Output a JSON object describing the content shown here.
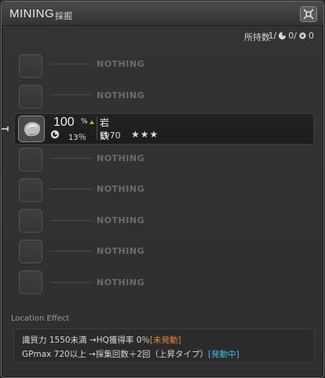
{
  "window": {
    "title": "MINING",
    "subtitle": "採掘",
    "close_icon": "settings-close-icon"
  },
  "header": {
    "holdings_label": "所持数",
    "holdings_prefix": "1/",
    "hq_count": "0/",
    "collectable_count": "0"
  },
  "slots": [
    {
      "text": "NOTHING"
    },
    {
      "text": "NOTHING"
    },
    {
      "text": "NOTHING"
    },
    {
      "text": "NOTHING"
    },
    {
      "text": "NOTHING"
    },
    {
      "text": "NOTHING"
    },
    {
      "text": "NOTHING"
    },
    {
      "text": "NOTHING"
    }
  ],
  "selected_item": {
    "gather_rate": "100",
    "gather_rate_unit": "%",
    "hq_rate": "13％",
    "name": "岩鉄",
    "level": "Lv70",
    "stars": "★★★",
    "icon": "iron-ore-icon"
  },
  "location_effect": {
    "title": "Location Effect",
    "line1_text": "識質力 1550未満 →HQ獲得率 0％",
    "line1_status": "[未発動]",
    "line2_text": "GPmax 720以上 →採集回数＋2回（上昇タイプ）",
    "line2_status": "[発動中]"
  },
  "colors": {
    "inactive_status": "#e8863a",
    "active_status": "#44b8e6",
    "rate_up_arrow": "#7fc86a"
  }
}
